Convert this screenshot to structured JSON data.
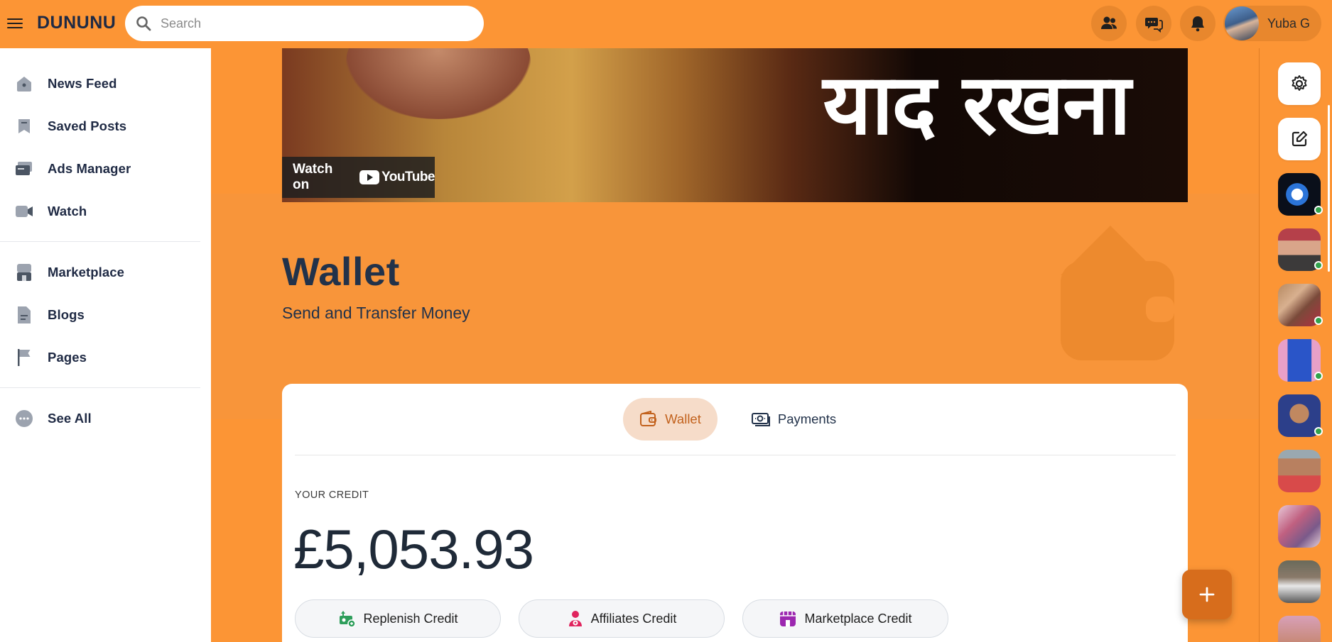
{
  "app": {
    "brand": "DUNUNU"
  },
  "search": {
    "placeholder": "Search"
  },
  "header": {
    "user_name": "Yuba G",
    "icons": [
      "friends-icon",
      "messages-icon",
      "notifications-icon"
    ]
  },
  "sidebar": {
    "items": [
      {
        "label": "News Feed",
        "icon": "home-icon"
      },
      {
        "label": "Saved Posts",
        "icon": "bookmark-icon"
      },
      {
        "label": "Ads Manager",
        "icon": "ads-icon"
      },
      {
        "label": "Watch",
        "icon": "video-icon"
      },
      {
        "label": "Marketplace",
        "icon": "store-icon"
      },
      {
        "label": "Blogs",
        "icon": "document-icon"
      },
      {
        "label": "Pages",
        "icon": "flag-icon"
      },
      {
        "label": "See All",
        "icon": "more-icon"
      }
    ]
  },
  "video": {
    "overlay_text": "याद रखना",
    "watch_on": "Watch on",
    "platform": "YouTube"
  },
  "page": {
    "title": "Wallet",
    "subtitle": "Send and Transfer Money"
  },
  "tabs": [
    {
      "label": "Wallet",
      "active": true
    },
    {
      "label": "Payments",
      "active": false
    }
  ],
  "credit": {
    "label": "YOUR CREDIT",
    "amount": "£5,053.93"
  },
  "actions": [
    {
      "label": "Replenish Credit",
      "color": "#2e9e5b"
    },
    {
      "label": "Affiliates Credit",
      "color": "#e0245e"
    },
    {
      "label": "Marketplace Credit",
      "color": "#9c27b0"
    }
  ],
  "colors": {
    "accent": "#fc9535",
    "accent_dark": "#d76d1c",
    "text_dark": "#22324a",
    "online": "#31a24c"
  }
}
